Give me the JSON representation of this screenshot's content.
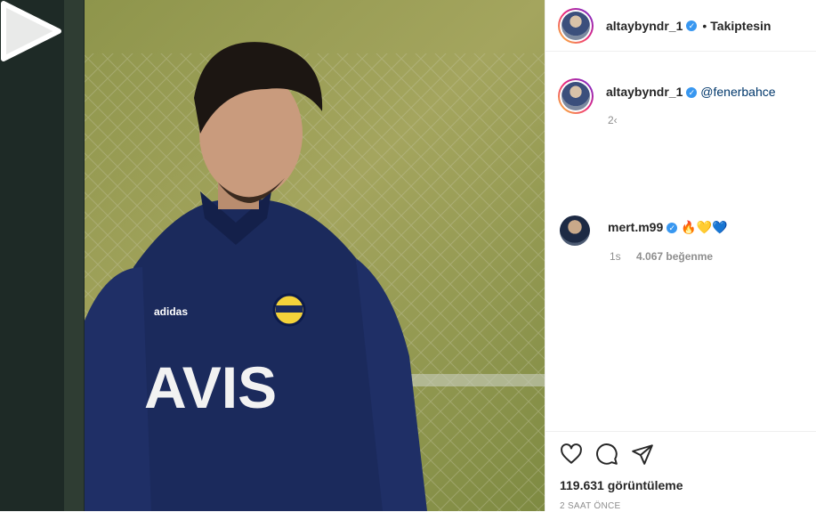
{
  "post": {
    "username": "altaybyndr_1",
    "follow_status": "Takiptesin",
    "caption_username": "altaybyndr_1",
    "caption_mention": "@fenerbahce",
    "caption_time": "2‹"
  },
  "comment": {
    "username": "mert.m99",
    "emojis": "🔥💛💙",
    "time": "1s",
    "likes": "4.067 beğenme"
  },
  "stats": {
    "views": "119.631 görüntüleme",
    "posted_ago": "2 SAAT ÖNCE"
  },
  "media": {
    "jersey_text": "AVIS",
    "brand_text": "adidas"
  },
  "colors": {
    "verified": "#3897f0",
    "jersey": "#1b2a5c",
    "background": "#6f7d3a"
  }
}
